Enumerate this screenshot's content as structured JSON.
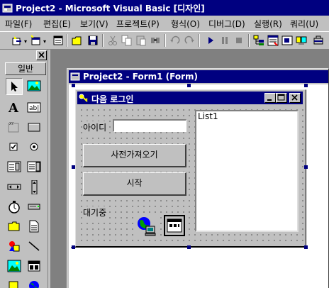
{
  "app": {
    "title": "Project2 - Microsoft Visual Basic [디자인]"
  },
  "menu": [
    "파일(F)",
    "편집(E)",
    "보기(V)",
    "프로젝트(P)",
    "형식(O)",
    "디버그(D)",
    "실행(R)",
    "쿼리(U)"
  ],
  "toolbar_icons": [
    "add-project-icon",
    "add-form-icon",
    "menu-editor-icon",
    "open-project-icon",
    "save-project-icon",
    "cut-icon",
    "copy-icon",
    "paste-icon",
    "find-icon",
    "undo-icon",
    "redo-icon",
    "start-icon",
    "break-icon",
    "end-icon",
    "project-explorer-icon",
    "properties-window-icon",
    "form-layout-icon"
  ],
  "toolbox": {
    "header": "일반",
    "tools": [
      "pointer",
      "picturebox",
      "label",
      "textbox",
      "frame",
      "commandbutton",
      "checkbox",
      "optionbutton",
      "combobox",
      "listbox",
      "hscrollbar",
      "vscrollbar",
      "timer",
      "drivelistbox",
      "dirlistbox",
      "filelistbox",
      "shape",
      "line",
      "image",
      "data"
    ]
  },
  "form_window": {
    "title": "Project2 - Form1 (Form)"
  },
  "designed_form": {
    "caption": "다음 로그인",
    "id_label": "아이디",
    "id_value": "",
    "fetch_button": "사전가져오기",
    "start_button": "시작",
    "status_label": "대기중",
    "listbox_items": [
      "List1"
    ]
  }
}
